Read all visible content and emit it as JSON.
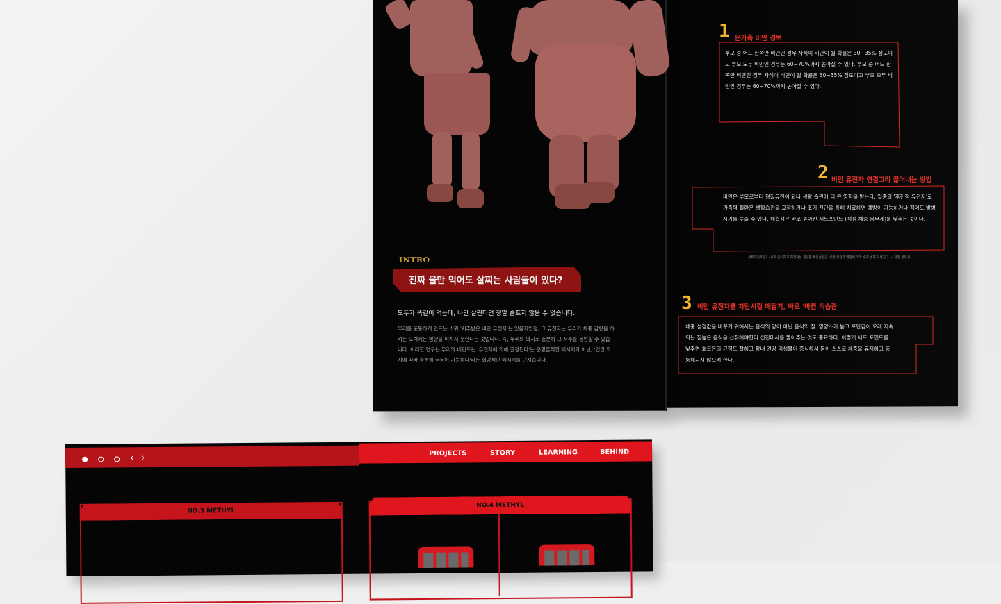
{
  "brochure": {
    "intro_tag": "INTRO",
    "intro_title": "진짜 물만 먹어도 살찌는 사람들이 있다?",
    "intro_lead": "모두가 똑같이 먹는데, 나만 살찐다면 정말 슬프지 않을 수 없습니다.",
    "intro_body": "우리를 뚱뚱하게 만드는 소위 '저주받은 비만 유전자'는 있을지언정, 그 유전자는 우리가 체중 감량을 하려는 노력에는 영향을 미치지 못한다는 것입니다. 즉, 우리의 의지로 충분히 그 저주를 봉인할 수 있습니다. 이러한 연구는 우리의 비만도는 '유전자에 의해 결정된다'는 운명론적인 메시지가 아닌, '인간 의지에 따라 충분히 극복이 가능하다'라는 희망적인 메시지를 던져줍니다.",
    "sections": [
      {
        "number": "1",
        "title": "온가족 비만 경보",
        "text": "부모 중 어느 한쪽만 비만인 경우 자식이 비만이 될 확률은 30~35% 정도이고 부모 모두 비만인 경우는 60~70%까지 높아질 수 있다. 부모 중 어느 한쪽만 비만인 경우 자식이 비만이 될 확률은 30~35% 정도이고 부모 모두 비만인 경우는 60~70%까지 높아질 수 있다."
      },
      {
        "number": "2",
        "title": "비만 유전자 연결고리  끊어내는 방법",
        "text": "비만은 부모로부터 형질유전이 되나 생활 습관에 더 큰 영향을 받는다. 일종의 '후천적 유전자'로 가족력 질환은 생활습관을 교정하거나 조기 진단을 통해 치료하면 예방이 가능하거나 적어도 발병 시기를 늦출 수 있다. 해결책은 바로 높아진 세트포인트 (적정 체중 몸무게)를 낮추는 것이다."
      },
      {
        "number": "3",
        "title": "비만 유전자를 차단시킬 메틸기, 바로 '바뀐 식습관'",
        "text": "체중 설정값을 바꾸기 위해서는 음식의 양이 아닌 음식의 질. 영양소가 높고 포만감이 오래 지속되는 질높은 음식을 섭취해야한다.신진대사를 뚫어주는 것도 중요하다. 이렇게 세트 포인트를 낮추면 호르몬의 균형도 잡히고 장내 건강 미생물이 증식해서 몸이 스스로 체중을 유지하고 뚱뚱해지지 않으려 한다."
      }
    ],
    "footnote": "세트포인트란? - 뇌가 인식하고 저장하는 개인별 체중설정값, 비만 유전자 발현에 따라 수치 변화가 생긴다. = 적정 몸무게"
  },
  "web": {
    "nav": [
      "PROJECTS",
      "STORY",
      "LEARNING",
      "BEHIND"
    ],
    "card_left_title": "NO.3 METHYL",
    "card_right_title": "NO.4 METHYL"
  },
  "colors": {
    "accent_red": "#e0161e",
    "number_gold": "#f2b531",
    "page_black": "#050505"
  }
}
